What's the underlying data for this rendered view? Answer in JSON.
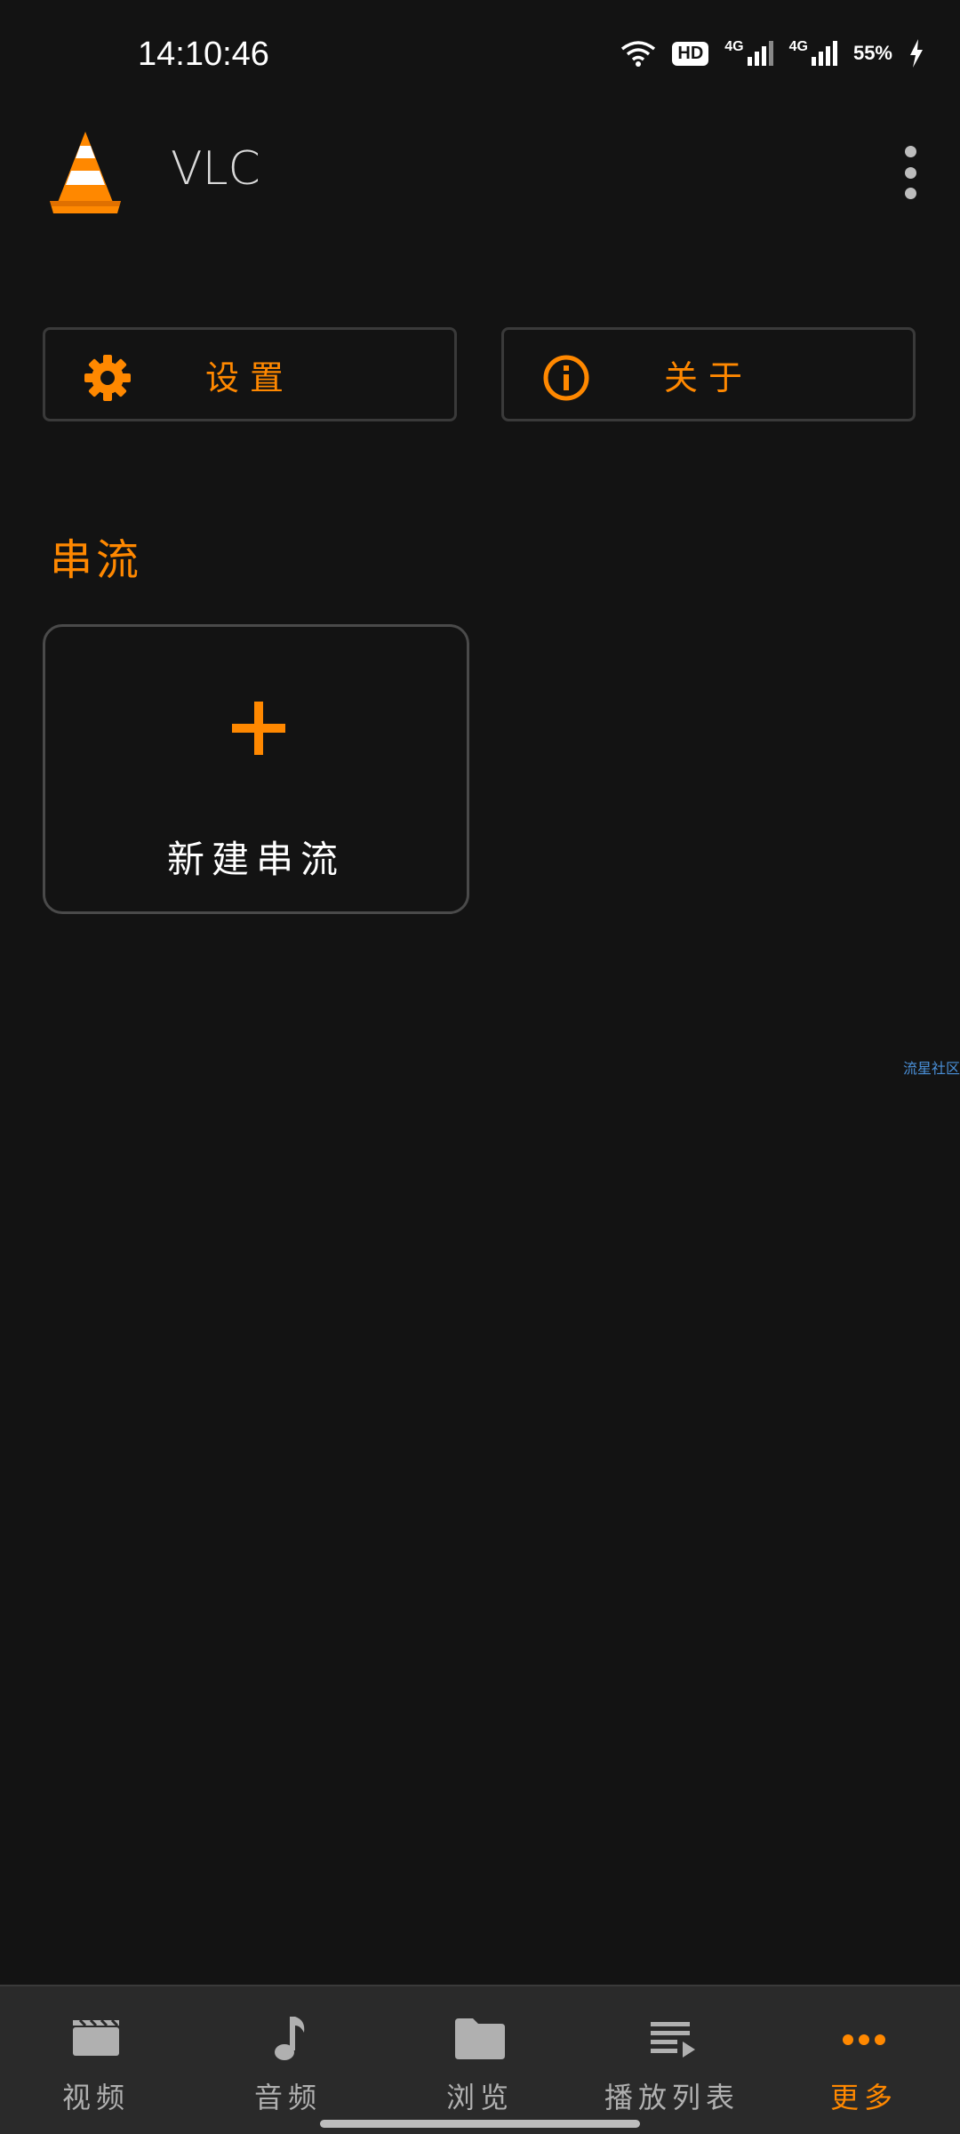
{
  "status_bar": {
    "time": "14:10:46",
    "hd_label": "HD",
    "network_1": "4G",
    "network_2": "4G",
    "battery": "55%"
  },
  "header": {
    "title": "VLC"
  },
  "actions": {
    "settings_label": "设置",
    "about_label": "关于"
  },
  "section": {
    "title": "串流"
  },
  "stream_card": {
    "label": "新建串流"
  },
  "watermark": "流星社区",
  "bottom_nav": {
    "items": [
      {
        "label": "视频",
        "icon": "video-icon"
      },
      {
        "label": "音频",
        "icon": "music-icon"
      },
      {
        "label": "浏览",
        "icon": "folder-icon"
      },
      {
        "label": "播放列表",
        "icon": "playlist-icon"
      },
      {
        "label": "更多",
        "icon": "more-icon"
      }
    ],
    "active_index": 4
  },
  "colors": {
    "background": "#131313",
    "accent": "#ff8800",
    "nav_background": "#2a2a2a",
    "border": "#3a3a3a",
    "inactive": "#b0b0b0"
  }
}
